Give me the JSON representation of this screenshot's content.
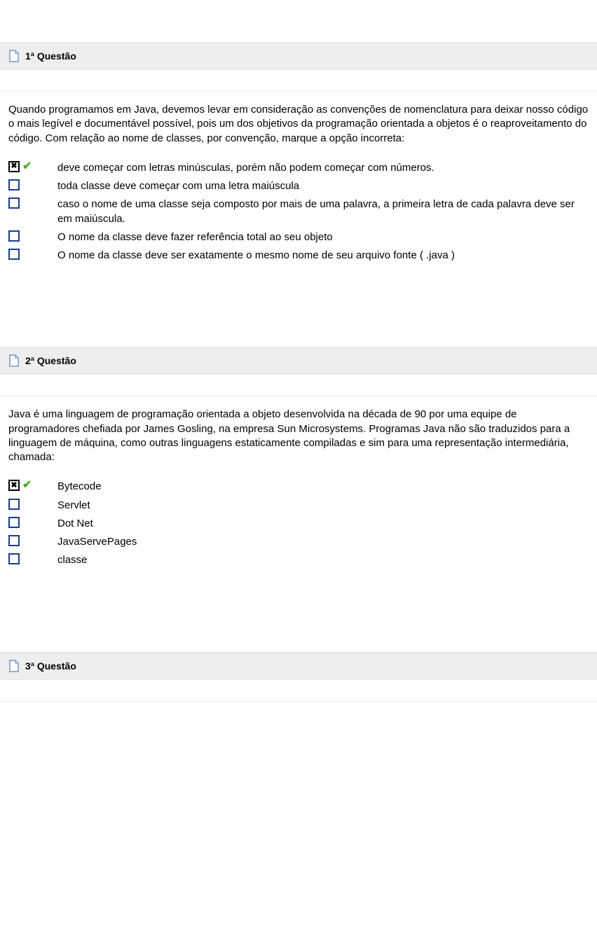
{
  "questions": [
    {
      "title": "1ª Questão",
      "prompt": "Quando programamos em Java, devemos levar em consideração as convenções de nomenclatura para deixar nosso código o mais legível e documentável possível, pois um dos objetivos da programação orientada a objetos é o reaproveitamento do código. Com relação ao nome de classes, por convenção, marque a opção incorreta:",
      "options": [
        {
          "text": "deve começar com letras minúsculas, porém não podem começar com números.",
          "checked": true,
          "correct": true
        },
        {
          "text": "toda classe deve começar com uma letra maiúscula",
          "checked": false,
          "correct": false
        },
        {
          "text": "caso o nome de uma classe seja composto por mais de uma palavra, a primeira letra de cada palavra deve ser em maiúscula.",
          "checked": false,
          "correct": false
        },
        {
          "text": "O nome da classe deve fazer referência total ao seu objeto",
          "checked": false,
          "correct": false
        },
        {
          "text": "O nome da classe deve ser exatamente o mesmo nome de seu arquivo fonte ( .java )",
          "checked": false,
          "correct": false
        }
      ]
    },
    {
      "title": "2ª Questão",
      "prompt": "Java é uma linguagem de programação orientada a objeto desenvolvida na década de 90 por uma equipe de programadores chefiada por James Gosling, na empresa Sun Microsystems. Programas Java não são traduzidos para a linguagem de máquina, como outras linguagens estaticamente compiladas e sim para uma representação intermediária, chamada:",
      "options": [
        {
          "text": "Bytecode",
          "checked": true,
          "correct": true
        },
        {
          "text": "Servlet",
          "checked": false,
          "correct": false
        },
        {
          "text": "Dot Net",
          "checked": false,
          "correct": false
        },
        {
          "text": "JavaServePages",
          "checked": false,
          "correct": false
        },
        {
          "text": "classe",
          "checked": false,
          "correct": false
        }
      ]
    },
    {
      "title": "3ª Questão",
      "prompt": "",
      "options": []
    }
  ]
}
